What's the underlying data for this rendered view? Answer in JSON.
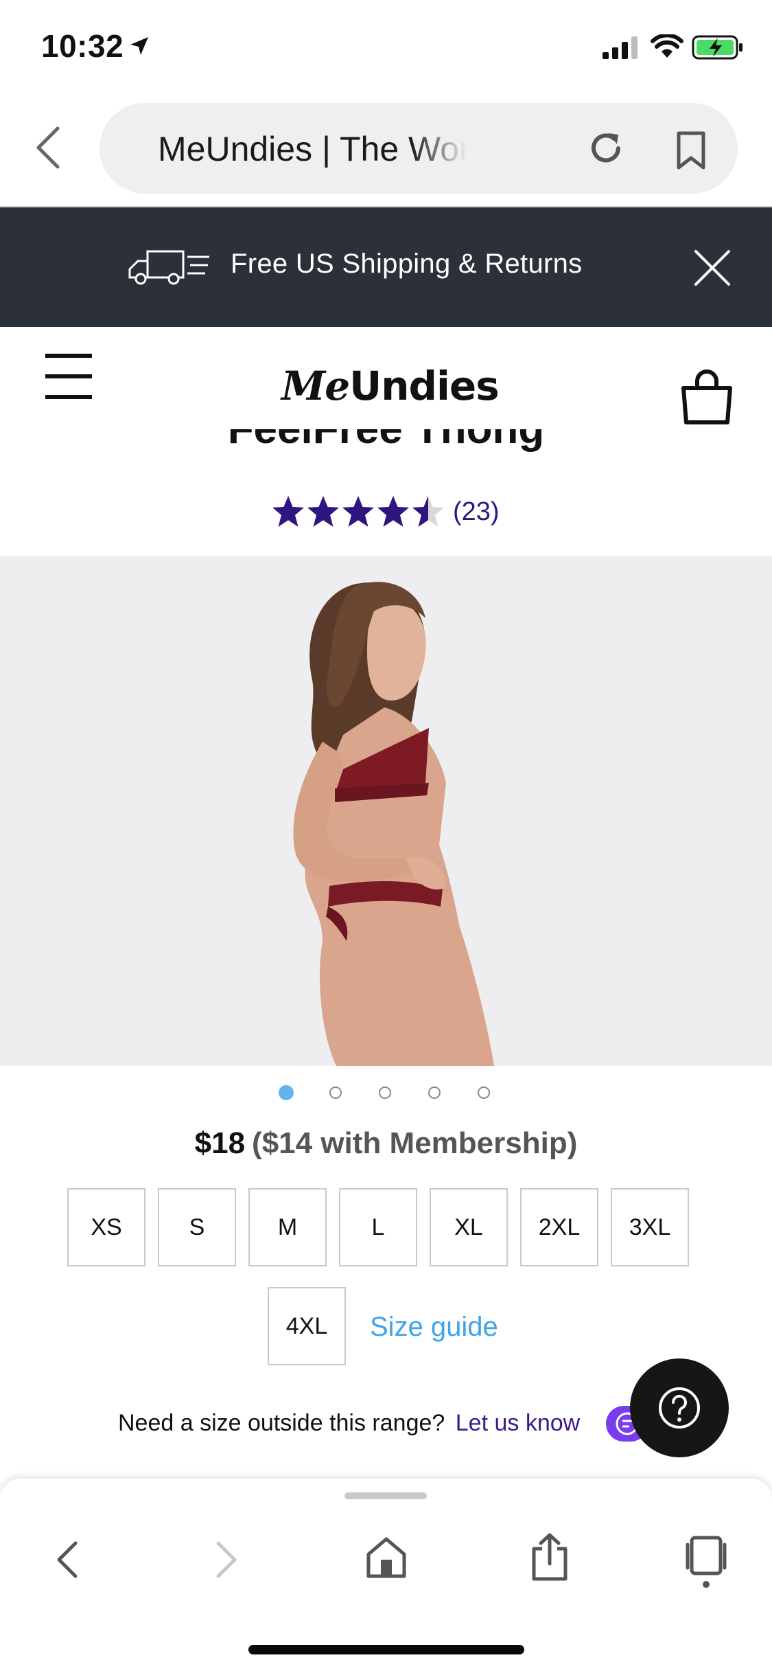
{
  "status_bar": {
    "time": "10:32",
    "icons": [
      "location-arrow-icon",
      "cellular-signal-icon",
      "wifi-icon",
      "battery-charging-icon"
    ]
  },
  "browser": {
    "url_text": "MeUndies | The World'",
    "icons": [
      "back-chevron-icon",
      "reload-icon",
      "bookmark-icon"
    ]
  },
  "promo": {
    "text": "Free US Shipping & Returns",
    "icons": [
      "truck-icon",
      "close-icon"
    ]
  },
  "header": {
    "logo_me": "Me",
    "logo_undies": "Undies",
    "icons": [
      "menu-icon",
      "shopping-bag-icon"
    ]
  },
  "product": {
    "title": "FeelFree Thong",
    "rating": 4.5,
    "rating_count": "(23)",
    "image_count": 5,
    "active_image": 1,
    "price": "$18",
    "member_price": "($14 with Membership)",
    "sizes": [
      "XS",
      "S",
      "M",
      "L",
      "XL",
      "2XL",
      "3XL",
      "4XL"
    ],
    "size_guide": "Size guide",
    "help_text": "Need a size outside this range?",
    "help_link": "Let us know"
  },
  "colors": {
    "banner_bg": "#2c3038",
    "star": "#2e1580",
    "link_blue": "#3fa4e8",
    "link_purple": "#3d1a8c",
    "chat_purple": "#7b3cf0",
    "active_dot": "#62b3f0"
  },
  "toolbar": {
    "icons": [
      "back-icon",
      "forward-icon",
      "home-icon",
      "share-icon",
      "tabs-icon"
    ]
  }
}
